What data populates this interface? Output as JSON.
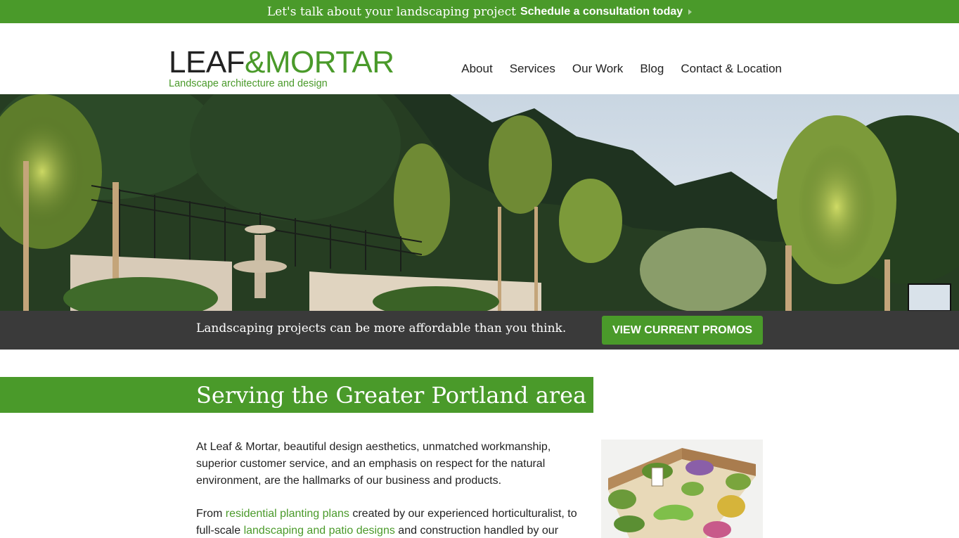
{
  "topbar": {
    "lead": "Let's talk about your landscaping project",
    "cta": "Schedule a consultation today",
    "icon": "chevron-right-icon"
  },
  "header": {
    "logo": {
      "part1": "LEAF",
      "amp": "&",
      "part2": "MORTAR",
      "tagline": "Landscape architecture and design"
    },
    "nav": [
      "About",
      "Services",
      "Our Work",
      "Blog",
      "Contact & Location"
    ]
  },
  "promo": {
    "text": "Landscaping projects can be more affordable than you think.",
    "button": "VIEW CURRENT PROMOS"
  },
  "section": {
    "title": "Serving the Greater Portland area"
  },
  "content": {
    "p1": "At Leaf & Mortar, beautiful design aesthetics, unmatched workmanship, superior customer service, and an emphasis on respect for the natural environment, are the hallmarks of our business and products.",
    "p2_before": "From ",
    "p2_link1": "residential planting plans",
    "p2_mid": " created by our experienced horticulturalist, to full-scale ",
    "p2_link2": "landscaping and patio designs",
    "p2_after": " and construction handled by our"
  },
  "colors": {
    "brand_green": "#4a9a2a",
    "dark_bar": "#3a3a3a"
  }
}
